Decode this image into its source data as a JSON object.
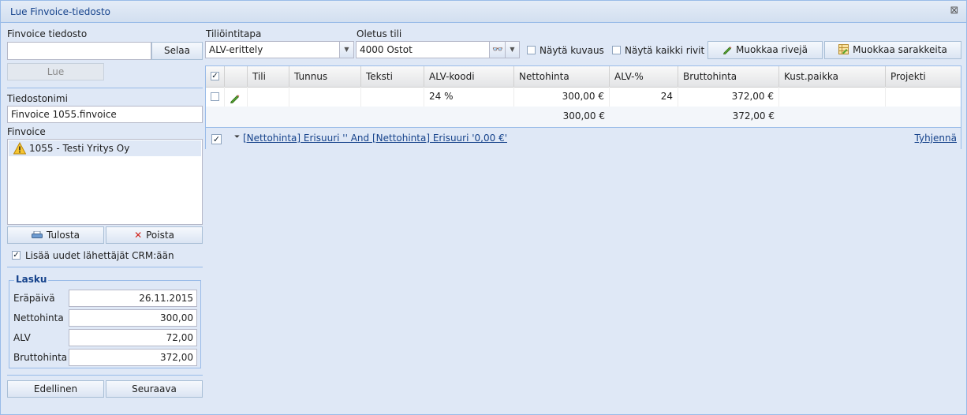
{
  "window": {
    "title": "Lue Finvoice-tiedosto"
  },
  "left": {
    "file_label": "Finvoice tiedosto",
    "file_value": "",
    "browse_label": "Selaa",
    "read_label": "Lue",
    "filename_label": "Tiedostonimi",
    "filename_value": "Finvoice 1055.finvoice",
    "finvoice_label": "Finvoice",
    "finvoice_items": [
      {
        "label": "1055 - Testi Yritys Oy",
        "icon": "warning-icon"
      }
    ],
    "print_label": "Tulosta",
    "delete_label": "Poista",
    "crm_checkbox_label": "Lisää uudet lähettäjät CRM:ään",
    "crm_checked": true,
    "invoice": {
      "legend": "Lasku",
      "due_label": "Eräpäivä",
      "due_value": "26.11.2015",
      "net_label": "Nettohinta",
      "net_value": "300,00",
      "vat_label": "ALV",
      "vat_value": "72,00",
      "gross_label": "Bruttohinta",
      "gross_value": "372,00"
    },
    "prev_label": "Edellinen",
    "next_label": "Seuraava"
  },
  "toolbar": {
    "posting_label": "Tiliöintitapa",
    "posting_value": "ALV-erittely",
    "default_account_label": "Oletus tili",
    "default_account_value": "4000 Ostot",
    "show_desc_label": "Näytä kuvaus",
    "show_all_rows_label": "Näytä kaikki rivit",
    "edit_rows_label": "Muokkaa rivejä",
    "edit_columns_label": "Muokkaa sarakkeita"
  },
  "grid": {
    "columns": [
      "Tili",
      "Tunnus",
      "Teksti",
      "ALV-koodi",
      "Nettohinta",
      "ALV-%",
      "Bruttohinta",
      "Kust.paikka",
      "Projekti"
    ],
    "rows": [
      {
        "tili": "",
        "tunnus": "",
        "teksti": "",
        "alv_koodi": "24 %",
        "nettohinta": "300,00 €",
        "alv_pct": "24",
        "bruttohinta": "372,00 €",
        "kustpaikka": "",
        "projekti": ""
      }
    ],
    "summary": {
      "nettohinta": "300,00 €",
      "bruttohinta": "372,00 €"
    },
    "filter_text": "[Nettohinta] Erisuuri '' And [Nettohinta] Erisuuri '0,00 €'",
    "clear_label": "Tyhjennä"
  },
  "colors": {
    "accent": "#15428b",
    "border": "#99bbe8",
    "background": "#dfe8f6"
  }
}
